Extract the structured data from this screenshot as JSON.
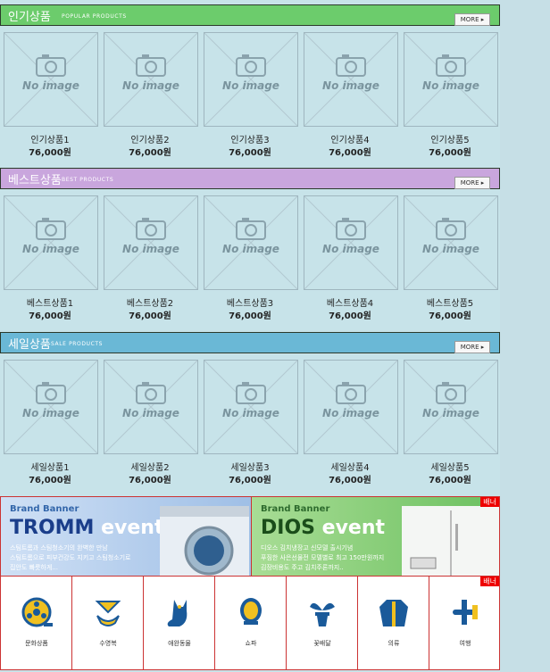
{
  "sections": [
    {
      "title": "인기상품",
      "subtitle": "POPULAR PRODUCTS",
      "color": "#6ccc6c",
      "more": "MORE",
      "items": [
        {
          "name": "인기상품1",
          "price": "76,000원"
        },
        {
          "name": "인기상품2",
          "price": "76,000원"
        },
        {
          "name": "인기상품3",
          "price": "76,000원"
        },
        {
          "name": "인기상품4",
          "price": "76,000원"
        },
        {
          "name": "인기상품5",
          "price": "76,000원"
        }
      ]
    },
    {
      "title": "베스트상품",
      "subtitle": "BEST PRODUCTS",
      "color": "#c9a6dd",
      "more": "MORE",
      "items": [
        {
          "name": "베스트상품1",
          "price": "76,000원"
        },
        {
          "name": "베스트상품2",
          "price": "76,000원"
        },
        {
          "name": "베스트상품3",
          "price": "76,000원"
        },
        {
          "name": "베스트상품4",
          "price": "76,000원"
        },
        {
          "name": "베스트상품5",
          "price": "76,000원"
        }
      ]
    },
    {
      "title": "세일상품",
      "subtitle": "SALE PRODUCTS",
      "color": "#6ab8d6",
      "more": "MORE",
      "items": [
        {
          "name": "세일상품1",
          "price": "76,000원"
        },
        {
          "name": "세일상품2",
          "price": "76,000원"
        },
        {
          "name": "세일상품3",
          "price": "76,000원"
        },
        {
          "name": "세일상품4",
          "price": "76,000원"
        },
        {
          "name": "세일상품5",
          "price": "76,000원"
        }
      ]
    }
  ],
  "no_image_text": "No image",
  "banners": [
    {
      "small": "Brand Banner",
      "brand": "TROMM",
      "event": "event",
      "lines": [
        "스팀트롬과 스팀청소기의 완벽한 만남",
        "스팀트롬으로 피부건강도 지키고 스팀청소기로",
        "집안도 빠릇하게..."
      ],
      "bg": "#b9d3ef",
      "brand_color": "#1a3d8a"
    },
    {
      "small": "Brand Banner",
      "brand": "DIOS",
      "event": "event",
      "lines": [
        "디오스 김치냉장고 신모델 출시기념",
        "푸짐한 사은선물전 모델별로 최고 150만원까지",
        "김장비용도 주고 김치주론까지.."
      ],
      "bg": "#8bd07a",
      "brand_color": "#1a4d1a"
    }
  ],
  "banner_tag": "배너",
  "categories": [
    {
      "label": "문화상품",
      "icon": "film-reel-icon"
    },
    {
      "label": "수영복",
      "icon": "swimsuit-icon"
    },
    {
      "label": "애완동물",
      "icon": "cat-icon"
    },
    {
      "label": "쇼파",
      "icon": "armchair-icon"
    },
    {
      "label": "꽃배달",
      "icon": "flower-pot-icon"
    },
    {
      "label": "의류",
      "icon": "jacket-icon"
    },
    {
      "label": "여행",
      "icon": "airplane-icon"
    }
  ],
  "category_tag": "배너",
  "colors": {
    "icon_yellow": "#f0c020",
    "icon_blue": "#1a5a9a",
    "border_red": "#cc3333"
  }
}
